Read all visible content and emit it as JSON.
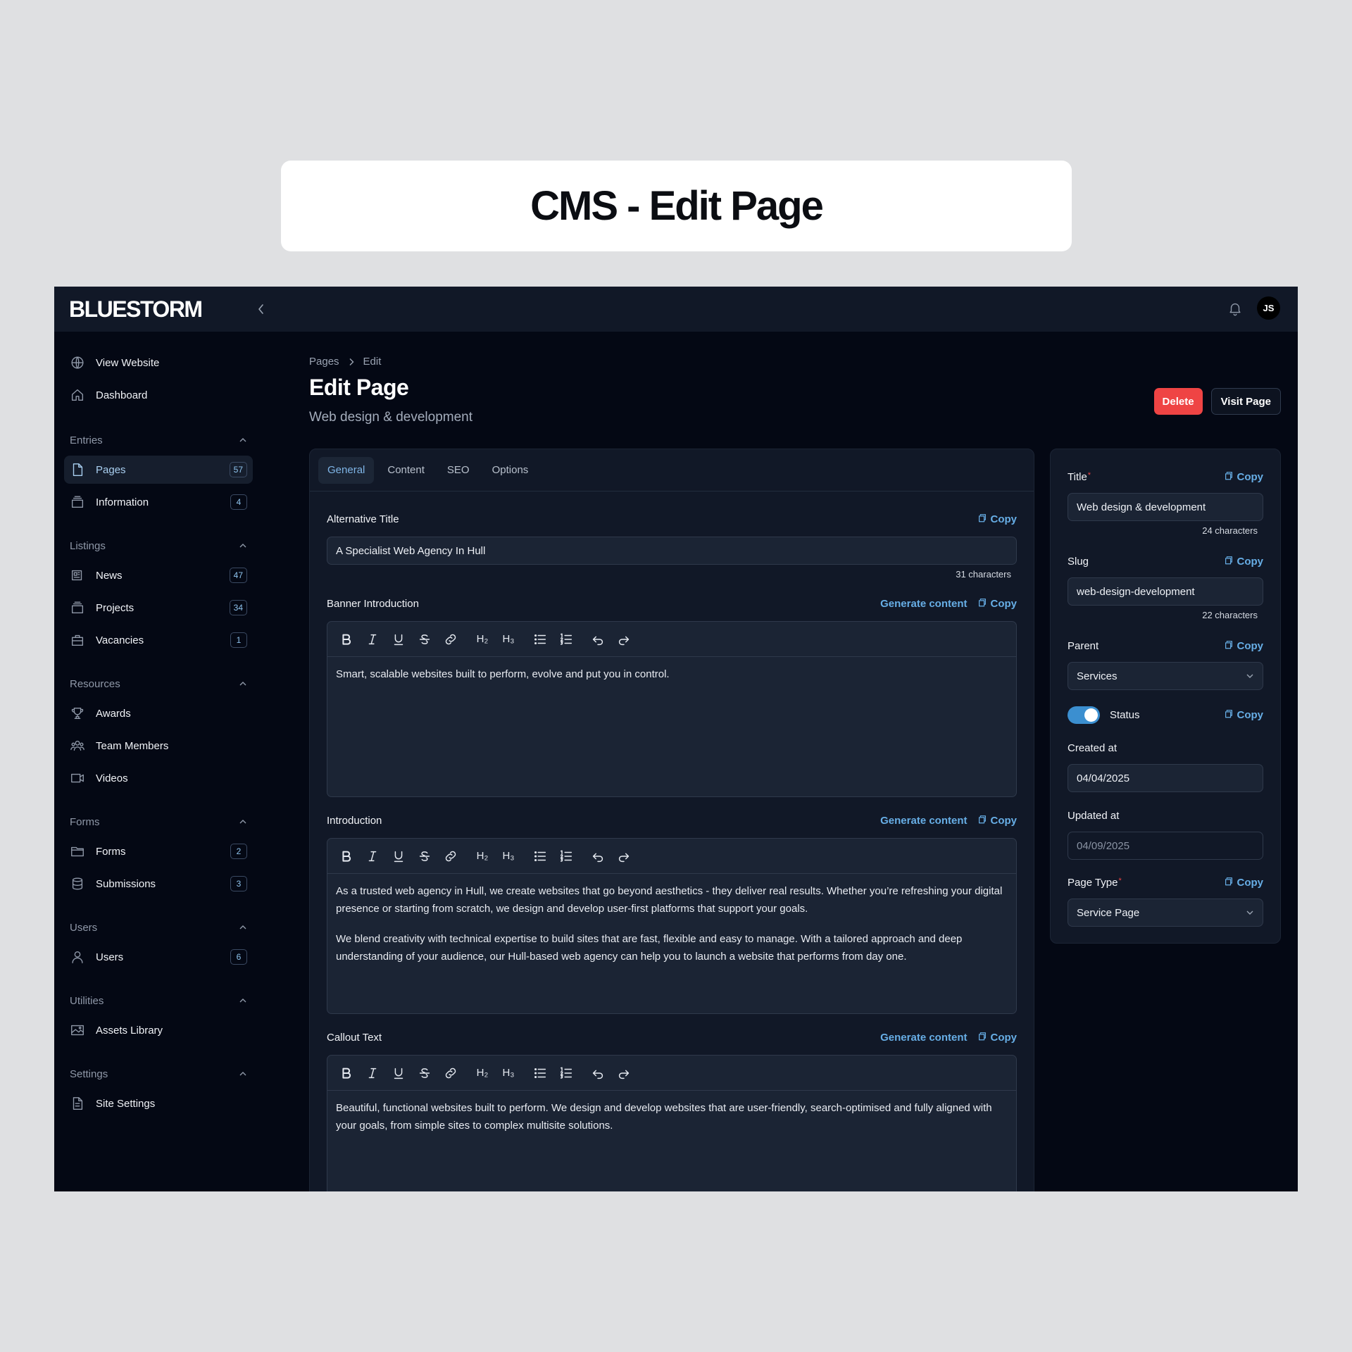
{
  "banner": {
    "title": "CMS - Edit Page"
  },
  "app": {
    "logo": "BLUESTORM",
    "user_initials": "JS"
  },
  "sidebar": {
    "top_items": [
      {
        "label": "View Website",
        "icon": "globe-icon"
      },
      {
        "label": "Dashboard",
        "icon": "home-icon"
      }
    ],
    "groups": [
      {
        "label": "Entries",
        "items": [
          {
            "label": "Pages",
            "count": "57",
            "icon": "page-icon",
            "active": true
          },
          {
            "label": "Information",
            "count": "4",
            "icon": "archive-icon"
          }
        ]
      },
      {
        "label": "Listings",
        "items": [
          {
            "label": "News",
            "count": "47",
            "icon": "newspaper-icon"
          },
          {
            "label": "Projects",
            "count": "34",
            "icon": "archive-icon"
          },
          {
            "label": "Vacancies",
            "count": "1",
            "icon": "briefcase-icon"
          }
        ]
      },
      {
        "label": "Resources",
        "items": [
          {
            "label": "Awards",
            "icon": "trophy-icon"
          },
          {
            "label": "Team Members",
            "icon": "users-icon"
          },
          {
            "label": "Videos",
            "icon": "video-icon"
          }
        ]
      },
      {
        "label": "Forms",
        "items": [
          {
            "label": "Forms",
            "count": "2",
            "icon": "folder-icon"
          },
          {
            "label": "Submissions",
            "count": "3",
            "icon": "database-icon"
          }
        ]
      },
      {
        "label": "Users",
        "items": [
          {
            "label": "Users",
            "count": "6",
            "icon": "user-icon"
          }
        ]
      },
      {
        "label": "Utilities",
        "items": [
          {
            "label": "Assets Library",
            "icon": "image-icon"
          }
        ]
      },
      {
        "label": "Settings",
        "items": [
          {
            "label": "Site Settings",
            "icon": "document-icon"
          }
        ]
      }
    ]
  },
  "header": {
    "breadcrumb": [
      "Pages",
      "Edit"
    ],
    "title": "Edit Page",
    "subtitle": "Web design & development",
    "delete_label": "Delete",
    "visit_label": "Visit Page"
  },
  "tabs": [
    "General",
    "Content",
    "SEO",
    "Options"
  ],
  "actions": {
    "copy": "Copy",
    "generate": "Generate content"
  },
  "general": {
    "alt_title": {
      "label": "Alternative Title",
      "value": "A Specialist Web Agency In Hull",
      "count": "31 characters"
    },
    "banner_intro": {
      "label": "Banner Introduction",
      "paragraphs": [
        "Smart, scalable websites built to perform, evolve and put you in control."
      ]
    },
    "introduction": {
      "label": "Introduction",
      "paragraphs": [
        "As a trusted web agency in Hull, we create websites that go beyond aesthetics - they deliver real results. Whether you’re refreshing your digital presence or starting from scratch, we design and develop user-first platforms that support your goals.",
        "We blend creativity with technical expertise to build sites that are fast, flexible and easy to manage. With a tailored approach and deep understanding of your audience, our Hull-based web agency can help you to launch a website that performs from day one."
      ]
    },
    "callout": {
      "label": "Callout Text",
      "paragraphs": [
        "Beautiful, functional websites built to perform. We design and develop websites that are user-friendly, search-optimised and fully aligned with your goals, from simple sites to complex multisite solutions."
      ]
    }
  },
  "toolbar": {
    "h2": "H₂",
    "h3": "H₃"
  },
  "details": {
    "title": {
      "label": "Title",
      "value": "Web design & development",
      "count": "24 characters"
    },
    "slug": {
      "label": "Slug",
      "value": "web-design-development",
      "count": "22 characters"
    },
    "parent": {
      "label": "Parent",
      "value": "Services"
    },
    "status": {
      "label": "Status",
      "enabled": true
    },
    "created": {
      "label": "Created at",
      "value": "04/04/2025"
    },
    "updated": {
      "label": "Updated at",
      "value": "04/09/2025"
    },
    "page_type": {
      "label": "Page Type",
      "value": "Service Page"
    }
  },
  "colors": {
    "accent": "#67aee6",
    "danger": "#ef4444",
    "background": "#040814",
    "panel": "#111827",
    "toggle": "#3b8fd0"
  }
}
